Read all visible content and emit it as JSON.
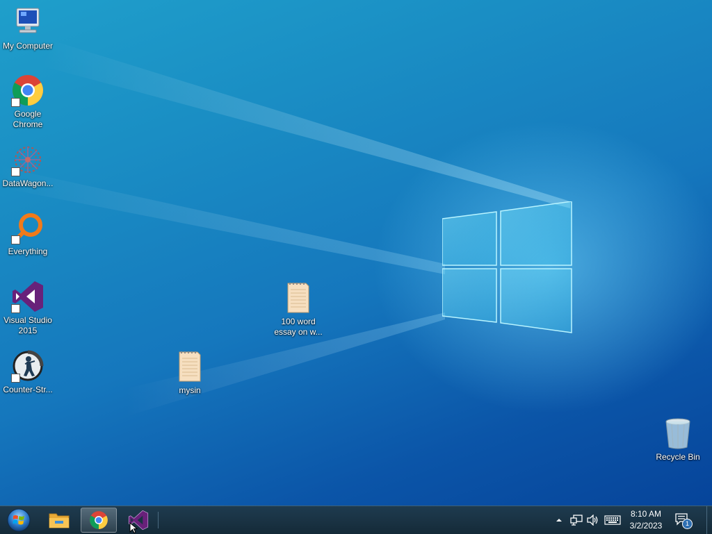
{
  "desktop": {
    "icons": [
      {
        "label": "My Computer",
        "icon": "computer-icon"
      },
      {
        "label": "Google Chrome",
        "icon": "chrome-icon"
      },
      {
        "label": "DataWagon...",
        "icon": "datawagon-icon"
      },
      {
        "label": "Everything",
        "icon": "everything-search-icon"
      },
      {
        "label": "Visual Studio 2015",
        "icon": "visual-studio-icon"
      },
      {
        "label": "Counter-Str...",
        "icon": "counter-strike-icon"
      },
      {
        "label": "mysin",
        "icon": "text-file-icon"
      },
      {
        "label": "100 word essay on w...",
        "icon": "text-file-icon"
      },
      {
        "label": "Recycle Bin",
        "icon": "recycle-bin-icon"
      }
    ]
  },
  "taskbar": {
    "start": {
      "icon": "windows-start-orb-icon"
    },
    "pinned": [
      {
        "name": "File Explorer",
        "icon": "folder-icon",
        "active": false
      },
      {
        "name": "Google Chrome",
        "icon": "chrome-icon",
        "active": true
      },
      {
        "name": "Visual Studio",
        "icon": "visual-studio-icon",
        "active": false
      }
    ],
    "tray": {
      "icons": [
        "chevron-up-icon",
        "network-icon",
        "speaker-icon",
        "keyboard-icon"
      ],
      "time": "8:10 AM",
      "date": "3/2/2023",
      "notification_count": "1"
    }
  },
  "colors": {
    "wallpaper_dark": "#06449a",
    "wallpaper_light": "#1f9fcb",
    "taskbar": "#1a3344",
    "vs_purple": "#68217a"
  }
}
